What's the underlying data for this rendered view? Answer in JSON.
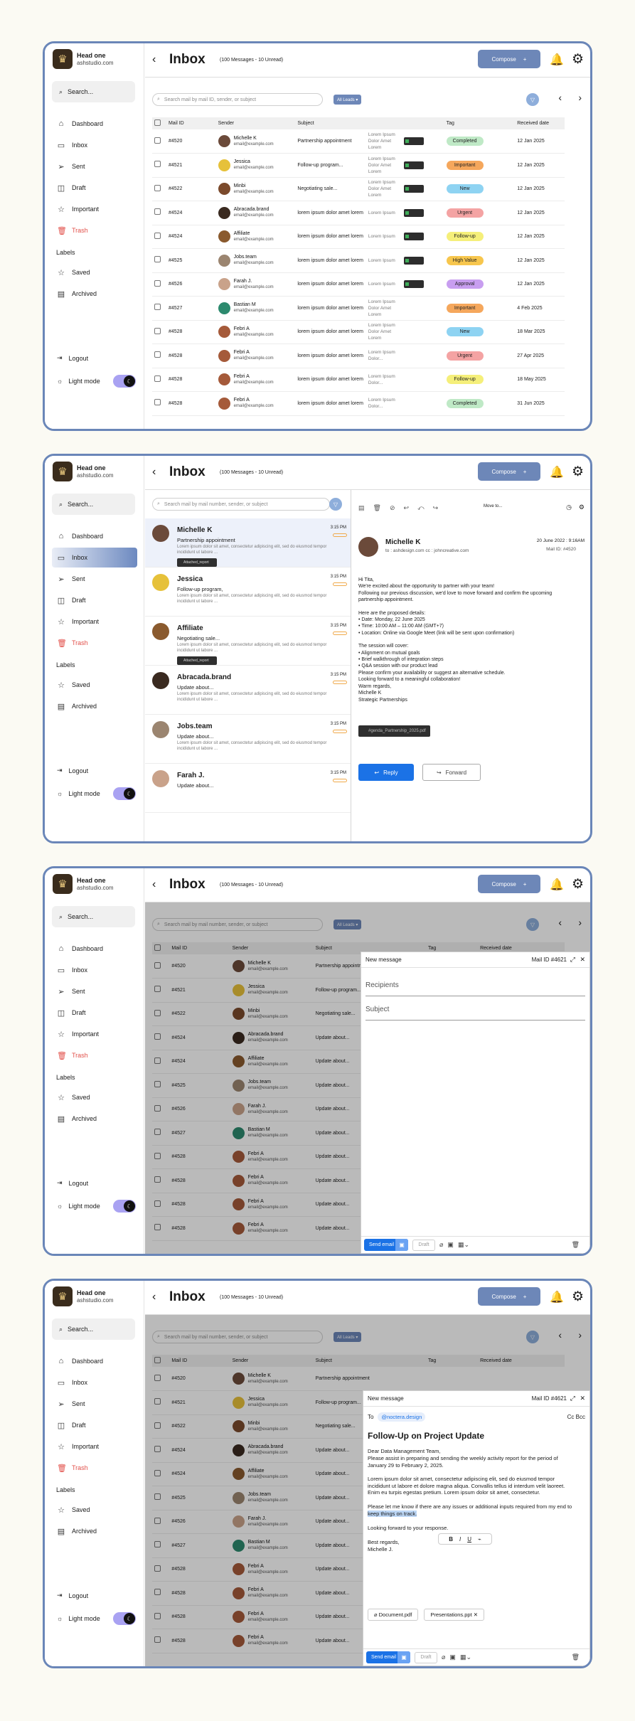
{
  "app": {
    "brand_name": "Head one",
    "brand_sub": "ashstudio.com",
    "search_label": "Search...",
    "nav": [
      {
        "label": "Dashboard",
        "icon": "home-icon",
        "glyph": "⌂"
      },
      {
        "label": "Inbox",
        "icon": "inbox-icon",
        "glyph": "▭"
      },
      {
        "label": "Sent",
        "icon": "send-icon",
        "glyph": "➢"
      },
      {
        "label": "Draft",
        "icon": "draft-icon",
        "glyph": "◫"
      },
      {
        "label": "Important",
        "icon": "star-icon",
        "glyph": "☆"
      },
      {
        "label": "Trash",
        "icon": "trash-icon",
        "glyph": "🗑"
      }
    ],
    "labels_heading": "Labels",
    "labels": [
      {
        "label": "Saved",
        "icon": "bookmark-icon",
        "glyph": "☆"
      },
      {
        "label": "Archived",
        "icon": "archive-icon",
        "glyph": "▤"
      }
    ],
    "logout": "Logout",
    "mode": "Light mode"
  },
  "header": {
    "title": "Inbox",
    "subtitle": "(100 Messages - 10 Unread)",
    "compose": "Compose"
  },
  "toolbar": {
    "search_placeholder1": "Search mail by mail ID, sender, or subject",
    "search_placeholder2": "Search mail by mail number, sender, or subject",
    "leads": "All Leads ▾"
  },
  "table": {
    "headers": [
      "Mail ID",
      "Sender",
      "Subject",
      "",
      "Tag",
      "Received date"
    ],
    "rows": [
      {
        "id": "#4520",
        "name": "Michelle K",
        "email": "email@example.com",
        "subject": "Partnership appointment",
        "short": "Partnership appointment",
        "preview": "Lorem Ipsum Dolor Amet Lorem",
        "tag": "Completed",
        "tag_color": "#bfe9c6",
        "date": "12 Jan 2025",
        "av": "#6b4a3a"
      },
      {
        "id": "#4521",
        "name": "Jessica",
        "email": "email@example.com",
        "subject": "Follow-up program...",
        "short": "Follow-up program...",
        "preview": "Lorem Ipsum Dolor Amet Lorem",
        "tag": "Important",
        "tag_color": "#f5a75c",
        "date": "12 Jan 2025",
        "av": "#e6c13a"
      },
      {
        "id": "#4522",
        "name": "Minbi",
        "email": "email@example.com",
        "subject": "Negotiating sale...",
        "short": "Negotiating sale...",
        "preview": "Lorem Ipsum Dolor Amet Lorem",
        "tag": "New",
        "tag_color": "#8ed3f2",
        "date": "12 Jan 2025",
        "av": "#7b4a2c"
      },
      {
        "id": "#4524",
        "name": "Abracada.brand",
        "email": "email@example.com",
        "subject": "lorem ipsum dolor amet lorem",
        "short": "Update about...",
        "preview": "Lorem Ipsum",
        "tag": "Urgent",
        "tag_color": "#f4a3a3",
        "date": "12 Jan 2025",
        "av": "#3a2a20"
      },
      {
        "id": "#4524",
        "name": "Affiliate",
        "email": "email@example.com",
        "subject": "lorem ipsum dolor amet lorem",
        "short": "Update about...",
        "preview": "Lorem Ipsum",
        "tag": "Follow-up",
        "tag_color": "#f5ef7a",
        "date": "12 Jan 2025",
        "av": "#8a5a2e"
      },
      {
        "id": "#4525",
        "name": "Jobs.team",
        "email": "email@example.com",
        "subject": "lorem ipsum dolor amet lorem",
        "short": "Update about...",
        "preview": "Lorem Ipsum",
        "tag": "High Value",
        "tag_color": "#f7c64d",
        "date": "12 Jan 2025",
        "av": "#9b8570"
      },
      {
        "id": "#4526",
        "name": "Farah J.",
        "email": "email@example.com",
        "subject": "lorem ipsum dolor amet lorem",
        "short": "Update about...",
        "preview": "Lorem Ipsum",
        "tag": "Approval",
        "tag_color": "#c89ef0",
        "date": "12 Jan 2025",
        "av": "#c9a28a"
      },
      {
        "id": "#4527",
        "name": "Bastian M",
        "email": "email@example.com",
        "subject": "lorem ipsum dolor amet lorem",
        "short": "Update about...",
        "preview": "Lorem Ipsum Dolor Amet Lorem",
        "tag": "Important",
        "tag_color": "#f5a75c",
        "date": "4 Feb 2025",
        "av": "#2c8a6e"
      },
      {
        "id": "#4528",
        "name": "Febri A",
        "email": "email@example.com",
        "subject": "lorem ipsum dolor amet lorem",
        "short": "Update about...",
        "preview": "Lorem Ipsum Dolor Amet Lorem",
        "tag": "New",
        "tag_color": "#8ed3f2",
        "date": "18 Mar 2025",
        "av": "#a55a3a"
      },
      {
        "id": "#4528",
        "name": "Febri A",
        "email": "email@example.com",
        "subject": "lorem ipsum dolor amet lorem",
        "short": "Update about...",
        "preview": "Lorem Ipsum Dolor...",
        "tag": "Urgent",
        "tag_color": "#f4a3a3",
        "date": "27 Apr 2025",
        "av": "#a55a3a"
      },
      {
        "id": "#4528",
        "name": "Febri A",
        "email": "email@example.com",
        "subject": "lorem ipsum dolor amet lorem",
        "short": "Update about...",
        "preview": "Lorem Ipsum Dolor...",
        "tag": "Follow-up",
        "tag_color": "#f5ef7a",
        "date": "18 May 2025",
        "av": "#a55a3a"
      },
      {
        "id": "#4528",
        "name": "Febri A",
        "email": "email@example.com",
        "subject": "lorem ipsum dolor amet lorem",
        "short": "Update about...",
        "preview": "Lorem Ipsum Dolor...",
        "tag": "Completed",
        "tag_color": "#bfe9c6",
        "date": "31 Jun 2025",
        "av": "#a55a3a"
      }
    ]
  },
  "list": [
    {
      "name": "Michelle K",
      "subject": "Partnership appointment",
      "time": "3:15 PM",
      "preview": "Lorem ipsum dolor sit amet, consectetur adipiscing elit, sed do eiusmod tempor incididunt ut labore ...",
      "attach": "Attached_report",
      "av": "#6b4a3a",
      "sel": true
    },
    {
      "name": "Jessica",
      "subject": "Follow-up program,",
      "time": "3:15 PM",
      "preview": "Lorem ipsum dolor sit amet, consectetur adipiscing elit, sed do eiusmod tempor incididunt ut labore ...",
      "attach": "",
      "av": "#e6c13a"
    },
    {
      "name": "Affiliate",
      "subject": "Negotiating sale...",
      "time": "3:15 PM",
      "preview": "Lorem ipsum dolor sit amet, consectetur adipiscing elit, sed do eiusmod tempor incididunt ut labore ...",
      "attach": "Attached_report",
      "av": "#8a5a2e"
    },
    {
      "name": "Abracada.brand",
      "subject": "Update about...",
      "time": "3:15 PM",
      "preview": "Lorem ipsum dolor sit amet, consectetur adipiscing elit, sed do eiusmod tempor incididunt ut labore ...",
      "attach": "",
      "av": "#3a2a20"
    },
    {
      "name": "Jobs.team",
      "subject": "Update about...",
      "time": "3:15 PM",
      "preview": "Lorem ipsum dolor sit amet, consectetur adipiscing elit, sed do eiusmod tempor incididunt ut labore ...",
      "attach": "",
      "av": "#9b8570"
    },
    {
      "name": "Farah J.",
      "subject": "Update about...",
      "time": "3:15 PM",
      "preview": "",
      "attach": "",
      "av": "#c9a28a"
    }
  ],
  "reader": {
    "sender": "Michelle K",
    "to": "to : ashdesign.com cc : johncreative.com",
    "date": "20 June 2022 : 9:16AM",
    "mailid": "Mail ID: #4520",
    "move": "Move to...",
    "body": [
      "Hi Tita,",
      "We're excited about the opportunity to partner with your team!",
      "Following our previous discussion, we'd love to move forward and confirm the upcoming partnership appointment.",
      "",
      "Here are the proposed details:",
      "•  Date: Monday, 22 June 2025",
      "•  Time: 10:00 AM – 11:00 AM (GMT+7)",
      "•  Location: Online via Google Meet (link will be sent upon confirmation)",
      "",
      "The session will cover:",
      "•  Alignment on mutual goals",
      "•  Brief walkthrough of integration steps",
      "•  Q&A session with our product lead",
      "Please confirm your availability or suggest an alternative schedule.",
      "Looking forward to a meaningful collaboration!",
      "Warm regards,",
      "Michelle K",
      "Strategic Partnerships"
    ],
    "attachment": "#genda_Partnership_2025.pdf",
    "reply": "Reply",
    "forward": "Forward"
  },
  "compose1": {
    "title": "New message",
    "mailid": "Mail ID #4621",
    "recipients": "Recipients",
    "subject": "Subject",
    "send": "Send email",
    "draft": "Draft"
  },
  "compose2": {
    "title": "New message",
    "mailid": "Mail ID #4621",
    "to": "To",
    "recipient": "@noctera.design",
    "ccbcc": "Cc Bcc",
    "subject": "Follow-Up on Project Update",
    "body": [
      "Dear Data Management Team,",
      "Please assist in preparing and sending the weekly activity report for the period of January 29 to February 2, 2025.",
      "",
      "Lorem ipsum dolor sit amet, consectetur adipiscing elit, sed do eiusmod tempor incididunt ut labore et dolore magna aliqua. Convallis tellus id interdum velit laoreet. Enim eu turpis egestas pretium. Lorem ipsum dolor sit amet, consectetur.",
      "",
      "Please let me know if there are any issues or additional inputs required from my end to"
    ],
    "highlight": "keep things on track.",
    "closing": [
      "Looking forward to your response.",
      "",
      "Best regards,",
      "Michelle J."
    ],
    "files": [
      "Document.pdf",
      "Presentations.ppt"
    ],
    "send": "Send email",
    "draft": "Draft"
  }
}
